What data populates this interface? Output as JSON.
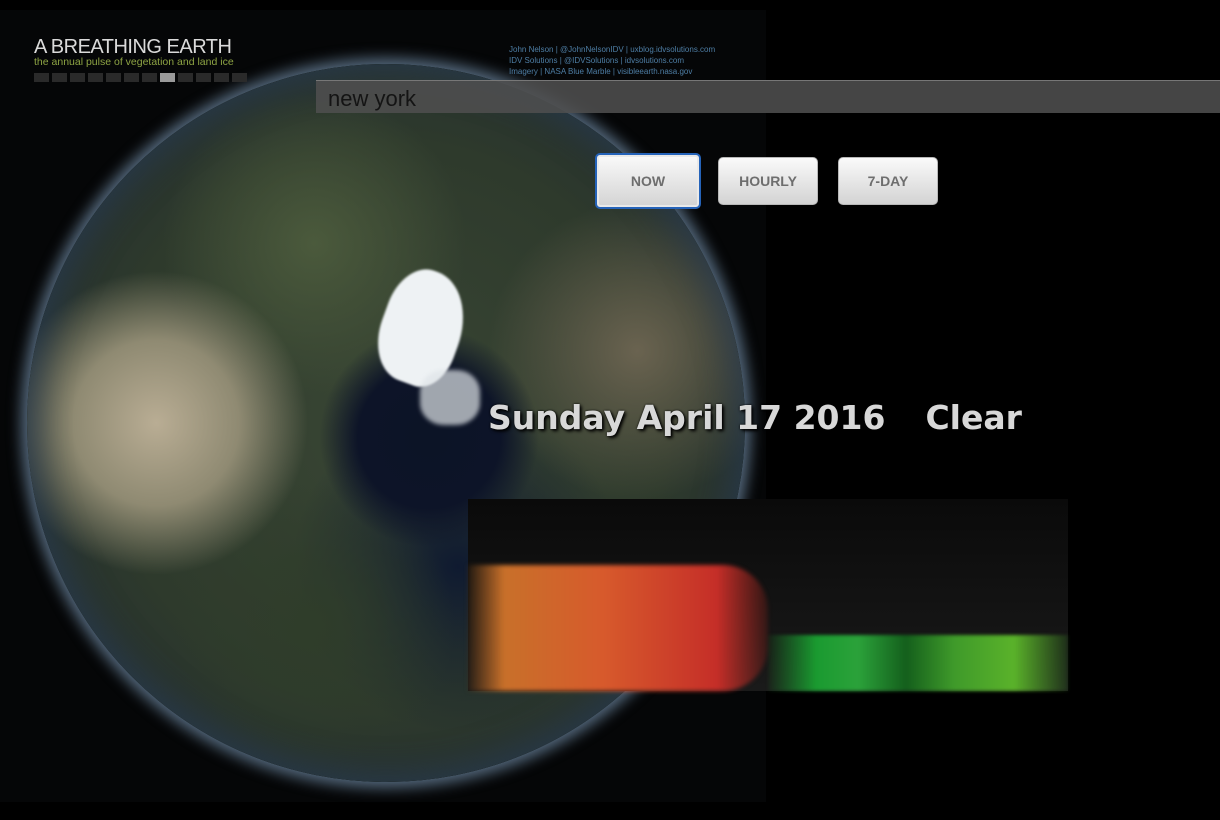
{
  "app": {
    "title": "A BREATHING EARTH",
    "subtitle": "the annual pulse of vegetation and land ice",
    "month_count": 12,
    "active_month_index": 7
  },
  "credits": {
    "line1": "John Nelson  |  @JohnNelsonIDV  |  uxblog.idvsolutions.com",
    "line2": "IDV Solutions  |  @IDVSolutions  |  idvsolutions.com",
    "line3": "Imagery  |  NASA Blue Marble  |  visibleearth.nasa.gov"
  },
  "search": {
    "value": "new york"
  },
  "modes": {
    "now": "NOW",
    "hourly": "HOURLY",
    "seven_day": "7-DAY",
    "active": "now"
  },
  "weather": {
    "date": "Sunday April 17 2016",
    "condition": "Clear"
  },
  "colors": {
    "accent_blue": "#2563b9",
    "title_gray": "#dadada",
    "subtitle_green": "#8ea444",
    "credit_blue": "#4e7ea5",
    "temp_orange": "#d75a2c",
    "temp_red": "#c52e28",
    "vegetation_green": "#2ba23a"
  }
}
